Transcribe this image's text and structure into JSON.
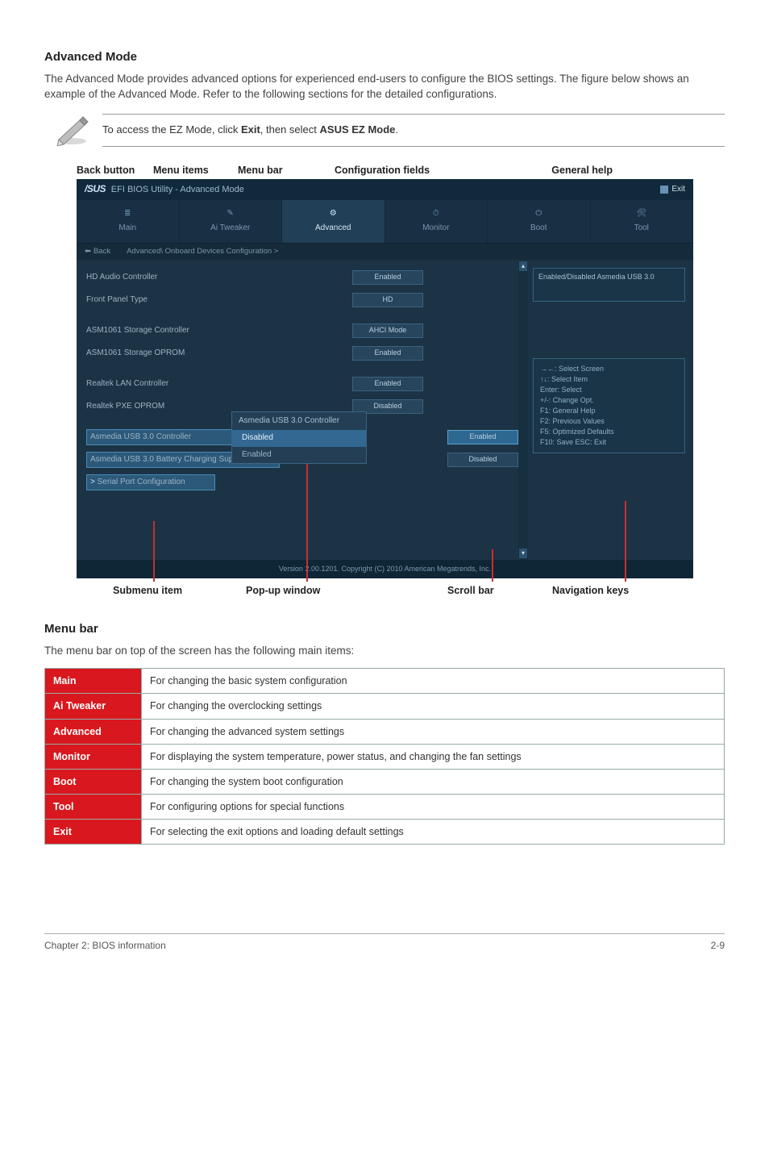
{
  "heading1": "Advanced Mode",
  "intro": "The Advanced Mode provides advanced options for experienced end-users to configure the BIOS settings. The figure below shows an example of the Advanced Mode. Refer to the following sections for the detailed configurations.",
  "note_prefix": "To access the EZ Mode, click ",
  "note_b1": "Exit",
  "note_mid": ", then select ",
  "note_b2": "ASUS EZ Mode",
  "note_suffix": ".",
  "labels_top": [
    "Back button",
    "Menu items",
    "Menu bar",
    "Configuration fields",
    "General help"
  ],
  "labels_bot": [
    "Submenu item",
    "Pop-up window",
    "Scroll bar",
    "Navigation keys"
  ],
  "bios": {
    "logo": "/SUS",
    "title": " EFI BIOS Utility - Advanced Mode",
    "exit": "Exit",
    "tabs": [
      "Main",
      "Ai Tweaker",
      "Advanced",
      "Monitor",
      "Boot",
      "Tool"
    ],
    "back_label": "Back",
    "breadcrumb": "Advanced\\ Onboard Devices Configuration >",
    "rows": [
      {
        "label": "HD Audio Controller",
        "val": "Enabled"
      },
      {
        "label": "Front Panel Type",
        "val": "HD"
      },
      {
        "label": "ASM1061 Storage Controller",
        "val": "AHCI Mode",
        "group": 2
      },
      {
        "label": "ASM1061 Storage OPROM",
        "val": "Enabled"
      },
      {
        "label": "Realtek LAN Controller",
        "val": "Enabled",
        "group": 3
      },
      {
        "label": "Realtek PXE OPROM",
        "val": "Disabled"
      },
      {
        "label": "Asmedia USB 3.0 Controller",
        "val": "Enabled",
        "hl": true,
        "group": 4
      },
      {
        "label": "Asmedia USB 3.0 Battery Charging Support",
        "val": "Disabled"
      },
      {
        "label": "Serial Port Configuration",
        "val": "",
        "sub": true
      }
    ],
    "popup": {
      "title": "Asmedia USB 3.0 Controller",
      "opts": [
        "Disabled",
        "Enabled"
      ],
      "selected": 1
    },
    "help_text": "Enabled/Disabled Asmedia USB 3.0",
    "nav_keys": [
      "→←: Select Screen",
      "↑↓: Select Item",
      "Enter: Select",
      "+/-: Change Opt.",
      "F1: General Help",
      "F2: Previous Values",
      "F5: Optimized Defaults",
      "F10: Save   ESC: Exit"
    ],
    "version": "Version 2.00.1201.   Copyright (C) 2010 American Megatrends, Inc."
  },
  "heading2": "Menu bar",
  "menubar_intro": "The menu bar on top of the screen has the following main items:",
  "table": [
    {
      "h": "Main",
      "d": "For changing the basic system configuration"
    },
    {
      "h": "Ai Tweaker",
      "d": "For changing the overclocking settings"
    },
    {
      "h": "Advanced",
      "d": "For changing the advanced system settings"
    },
    {
      "h": "Monitor",
      "d": "For displaying the system temperature, power status, and changing the fan settings"
    },
    {
      "h": "Boot",
      "d": "For changing the system boot configuration"
    },
    {
      "h": "Tool",
      "d": "For configuring options for special functions"
    },
    {
      "h": "Exit",
      "d": "For selecting the exit options and loading default settings"
    }
  ],
  "footer_left": "Chapter 2: BIOS information",
  "footer_right": "2-9"
}
